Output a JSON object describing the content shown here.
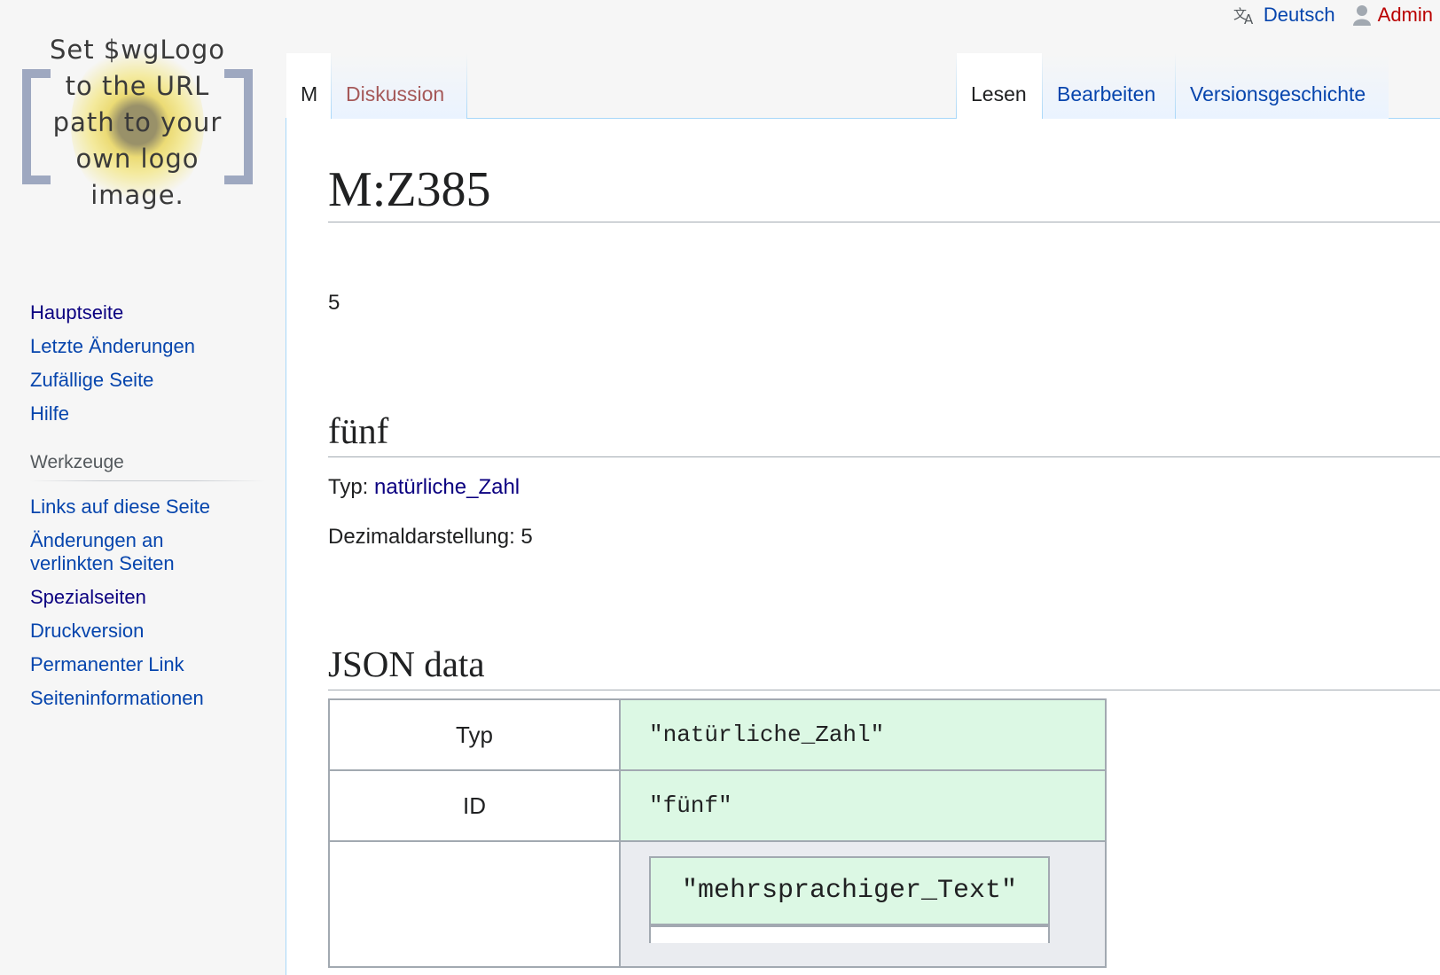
{
  "personal": {
    "language": "Deutsch",
    "user": "Admin"
  },
  "logo": {
    "lines": [
      "Set $wgLogo",
      "to the URL",
      "path to your",
      "own logo",
      "image."
    ]
  },
  "nav": {
    "items": [
      "Hauptseite",
      "Letzte Änderungen",
      "Zufällige Seite",
      "Hilfe"
    ]
  },
  "tools": {
    "heading": "Werkzeuge",
    "items": [
      "Links auf diese Seite",
      "Änderungen an verlinkten Seiten",
      "Spezialseiten",
      "Druckversion",
      "Permanenter Link",
      "Seiteninformationen"
    ]
  },
  "tabs": {
    "namespace": "M",
    "discussion": "Diskussion",
    "read": "Lesen",
    "edit": "Bearbeiten",
    "history": "Versionsgeschichte"
  },
  "page": {
    "title": "M:Z385",
    "value": "5",
    "label_heading": "fünf",
    "type_label": "Typ:",
    "type_link": "natürliche_Zahl",
    "decimal": "Dezimaldarstellung: 5",
    "json_heading": "JSON data"
  },
  "json_table": {
    "rows": [
      {
        "key": "Typ",
        "value": "\"natürliche_Zahl\""
      },
      {
        "key": "ID",
        "value": "\"fünf\""
      }
    ],
    "nested_value": "\"mehrsprachiger_Text\""
  },
  "colors": {
    "link": "#0645ad",
    "visited": "#0b0080",
    "new_link": "#a55858",
    "user_link": "#ba0000",
    "value_cell": "#dcf8e4"
  }
}
